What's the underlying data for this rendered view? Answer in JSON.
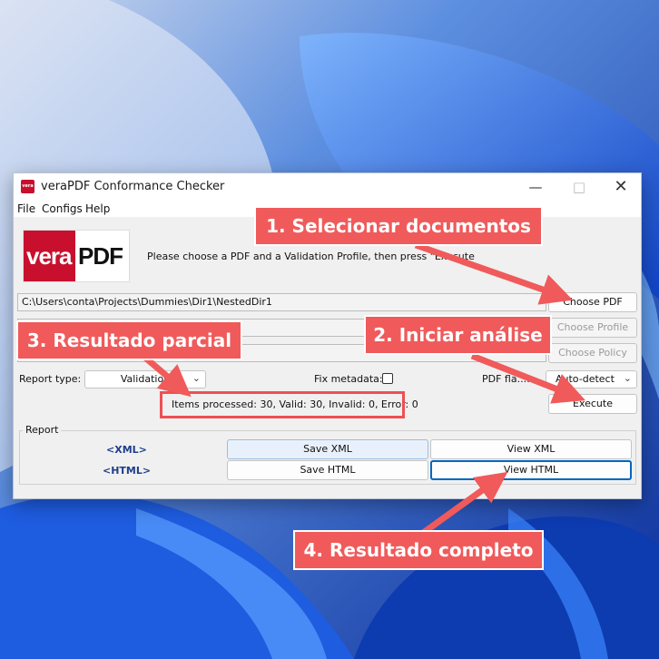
{
  "window": {
    "title": "veraPDF Conformance Checker",
    "icon_text": "vera",
    "minimize_icon": "minimize-icon",
    "maximize_icon": "maximize-icon",
    "close_icon": "close-icon"
  },
  "menu": [
    "File",
    "Configs",
    "Help"
  ],
  "logo": {
    "vera": "vera",
    "pdf": "PDF"
  },
  "instructions": "Please choose a PDF and a Validation Profile, then press \"Execute",
  "pdf_path": "C:\\Users\\conta\\Projects\\Dummies\\Dir1\\NestedDir1",
  "buttons": {
    "choose_pdf": "Choose PDF",
    "choose_profile": "Choose Profile",
    "choose_policy": "Choose Policy",
    "execute": "Execute"
  },
  "report_type": {
    "label": "Report type:",
    "value": "Validation"
  },
  "fix_metadata": {
    "label": "Fix metadata:",
    "checked": false
  },
  "pdf_flavour": {
    "label": "PDF fla...:",
    "value": "Auto-detect"
  },
  "status": "Items processed: 30, Valid: 30, Invalid: 0, Error: 0",
  "report": {
    "legend": "Report",
    "xml_label": "<XML>",
    "html_label": "<HTML>",
    "save_xml": "Save XML",
    "view_xml": "View XML",
    "save_html": "Save HTML",
    "view_html": "View HTML"
  },
  "callouts": {
    "step1": "1. Selecionar documentos",
    "step2": "2. Iniciar análise",
    "step3": "3. Resultado parcial",
    "step4": "4. Resultado completo"
  },
  "colors": {
    "accent": "#f05a5b",
    "brand_red": "#c8102e",
    "focus": "#0067c0"
  }
}
